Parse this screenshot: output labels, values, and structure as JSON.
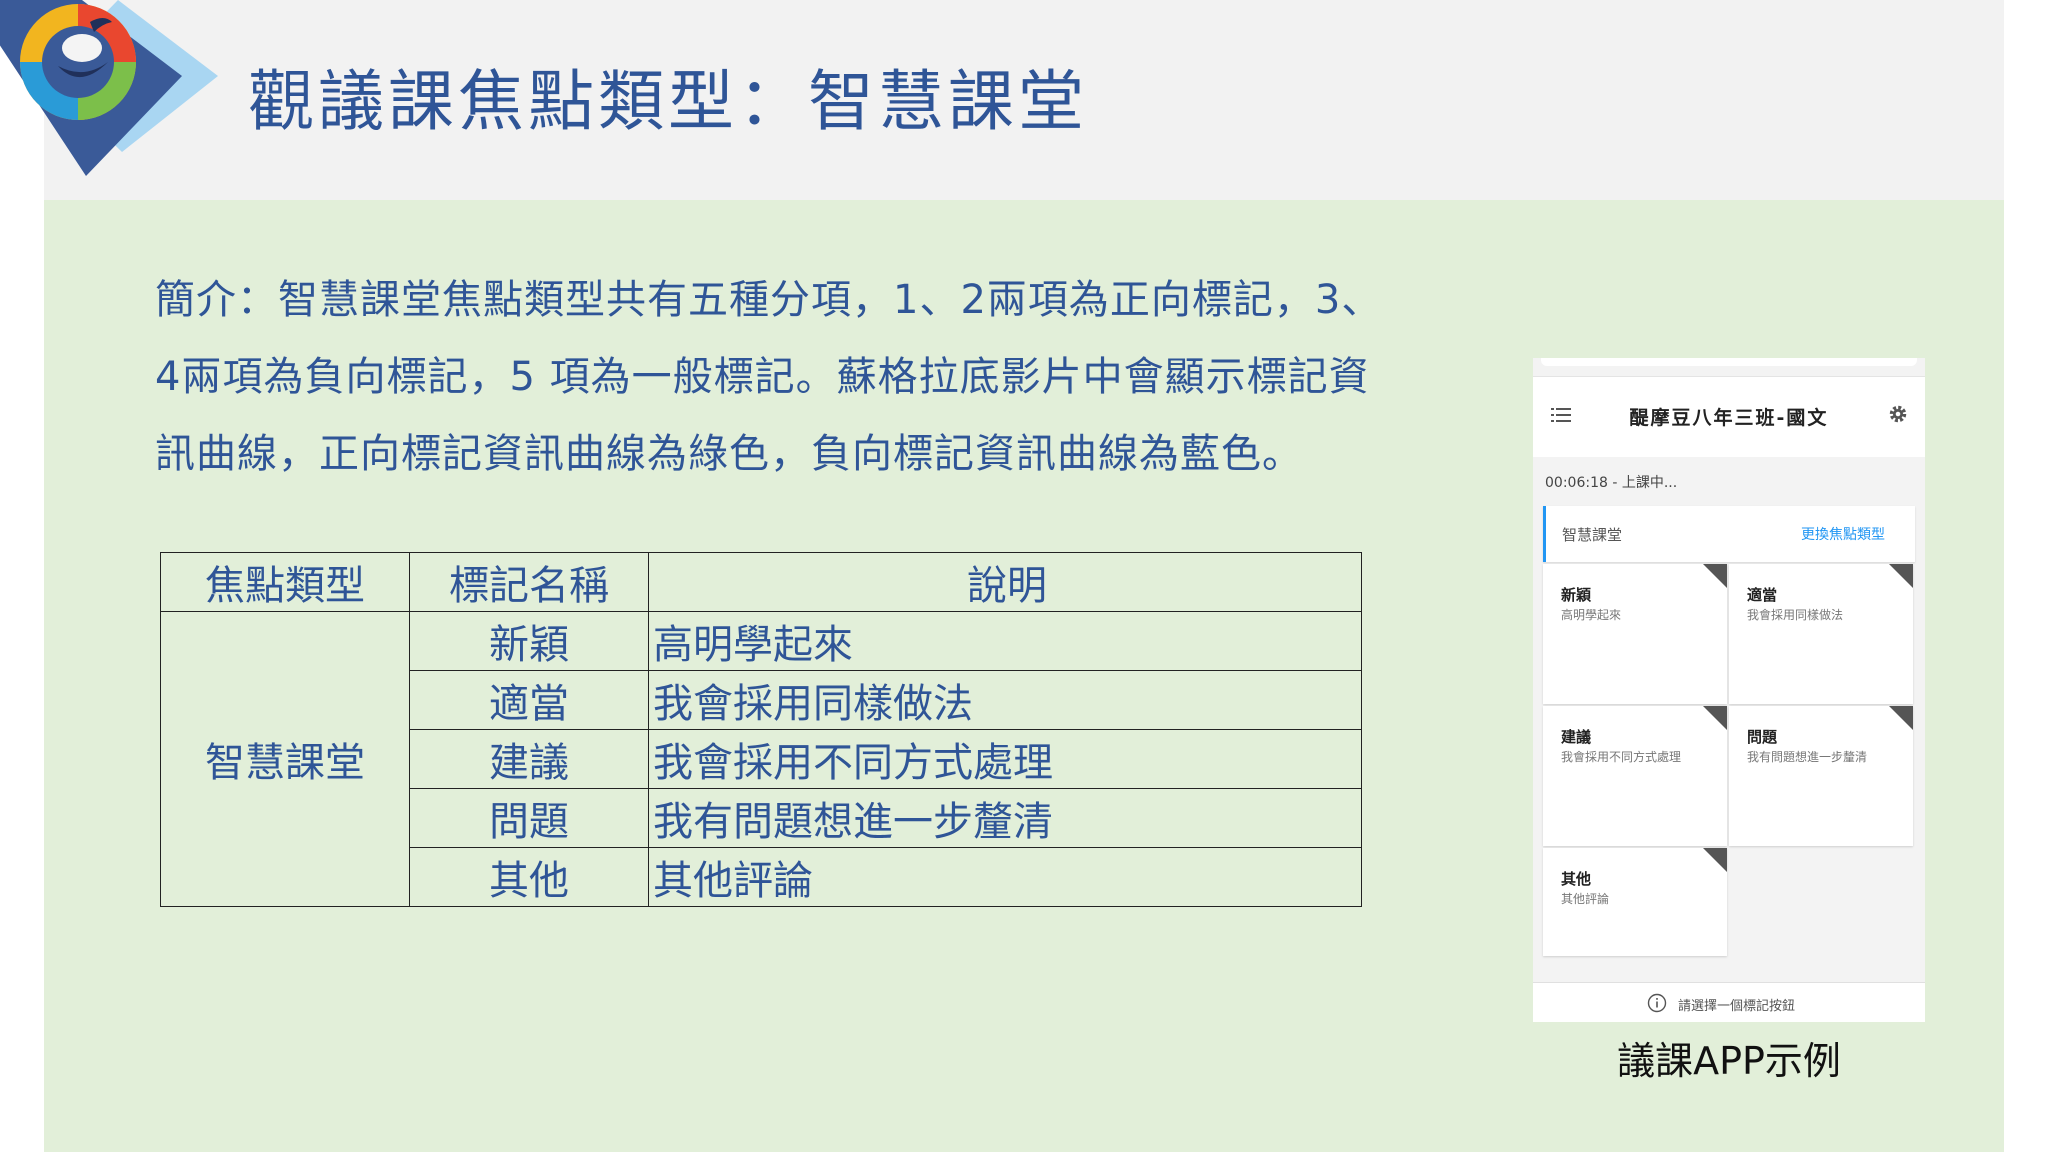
{
  "slide": {
    "title": "觀議課焦點類型：智慧課堂",
    "intro_lines": [
      "簡介：智慧課堂焦點類型共有五種分項，1、2兩項為正向標記，3、",
      "4兩項為負向標記，5 項為一般標記。蘇格拉底影片中會顯示標記資",
      "訊曲線，正向標記資訊曲線為綠色，負向標記資訊曲線為藍色。"
    ],
    "caption": "議課APP示例"
  },
  "table": {
    "headers": [
      "焦點類型",
      "標記名稱",
      "說明"
    ],
    "group_label": "智慧課堂",
    "rows": [
      {
        "name": "新穎",
        "desc": "高明學起來"
      },
      {
        "name": "適當",
        "desc": "我會採用同樣做法"
      },
      {
        "name": "建議",
        "desc": "我會採用不同方式處理"
      },
      {
        "name": "問題",
        "desc": "我有問題想進一步釐清"
      },
      {
        "name": "其他",
        "desc": "其他評論"
      }
    ]
  },
  "app": {
    "title": "醍摩豆八年三班-國文",
    "menu_icon": "menu-icon",
    "settings_icon": "gear-icon",
    "timer": "00:06:18 - 上課中...",
    "focus_label": "智慧課堂",
    "change_focus_link": "更換焦點類型",
    "cards": [
      {
        "title": "新穎",
        "desc": "高明學起來"
      },
      {
        "title": "適當",
        "desc": "我會採用同樣做法"
      },
      {
        "title": "建議",
        "desc": "我會採用不同方式處理"
      },
      {
        "title": "問題",
        "desc": "我有問題想進一步釐清"
      },
      {
        "title": "其他",
        "desc": "其他評論"
      }
    ],
    "hint_icon": "info-icon",
    "hint": "請選擇一個標記按鈕"
  },
  "colors": {
    "title_blue": "#2f5597",
    "content_green": "#e2efd9",
    "header_gray": "#f2f2f2",
    "accent_blue": "#2196f3",
    "logo_dark_blue": "#3a5a98",
    "logo_light_blue": "#a9d6f2"
  }
}
